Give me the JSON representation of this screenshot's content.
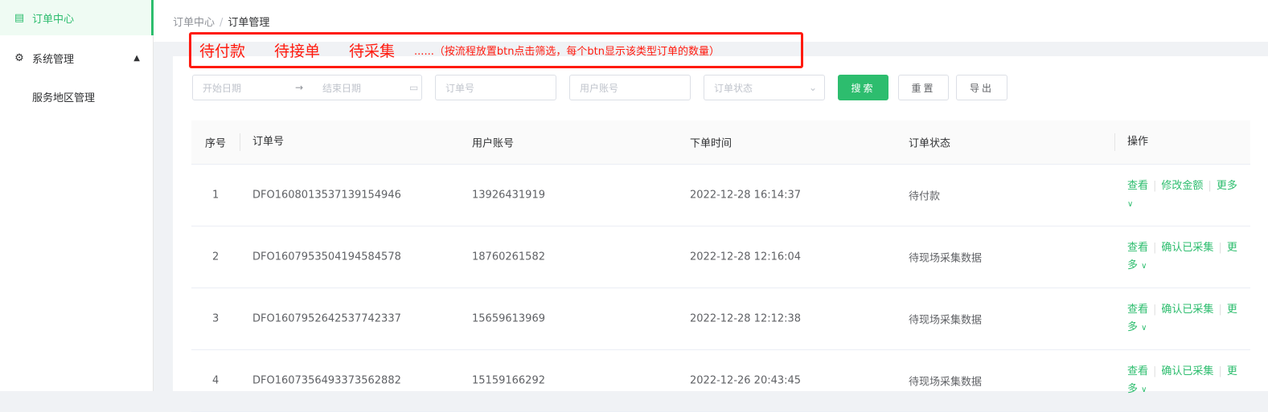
{
  "sidebar": {
    "items": [
      {
        "label": "订单中心",
        "icon": "document-icon",
        "active": true
      },
      {
        "label": "系统管理",
        "icon": "gear-icon",
        "expanded": true
      },
      {
        "label": "服务地区管理"
      }
    ]
  },
  "breadcrumb": [
    "订单中心",
    "订单管理"
  ],
  "annotation": {
    "buttons": [
      "待付款",
      "待接单",
      "待采集"
    ],
    "note": "......（按流程放置btn点击筛选，每个btn显示该类型订单的数量）"
  },
  "filters": {
    "start_date": "开始日期",
    "end_date": "结束日期",
    "order_no": "订单号",
    "user_account": "用户账号",
    "order_status": "订单状态",
    "search": "搜索",
    "reset": "重置",
    "export": "导出"
  },
  "table": {
    "headers": [
      "序号",
      "订单号",
      "用户账号",
      "下单时间",
      "订单状态",
      "操作"
    ],
    "rows": [
      {
        "idx": "1",
        "order": "DFO1608013537139154946",
        "account": "13926431919",
        "time": "2022-12-28 16:14:37",
        "status": "待付款",
        "actions": [
          "查看",
          "修改金额",
          "更多"
        ]
      },
      {
        "idx": "2",
        "order": "DFO1607953504194584578",
        "account": "18760261582",
        "time": "2022-12-28 12:16:04",
        "status": "待现场采集数据",
        "actions": [
          "查看",
          "确认已采集",
          "更多"
        ]
      },
      {
        "idx": "3",
        "order": "DFO1607952642537742337",
        "account": "15659613969",
        "time": "2022-12-28 12:12:38",
        "status": "待现场采集数据",
        "actions": [
          "查看",
          "确认已采集",
          "更多"
        ]
      },
      {
        "idx": "4",
        "order": "DFO1607356493373562882",
        "account": "15159166292",
        "time": "2022-12-26 20:43:45",
        "status": "待现场采集数据",
        "actions": [
          "查看",
          "确认已采集",
          "更多"
        ]
      }
    ]
  },
  "colors": {
    "accent": "#2dbd6e",
    "annotation": "#ff1a0e"
  }
}
